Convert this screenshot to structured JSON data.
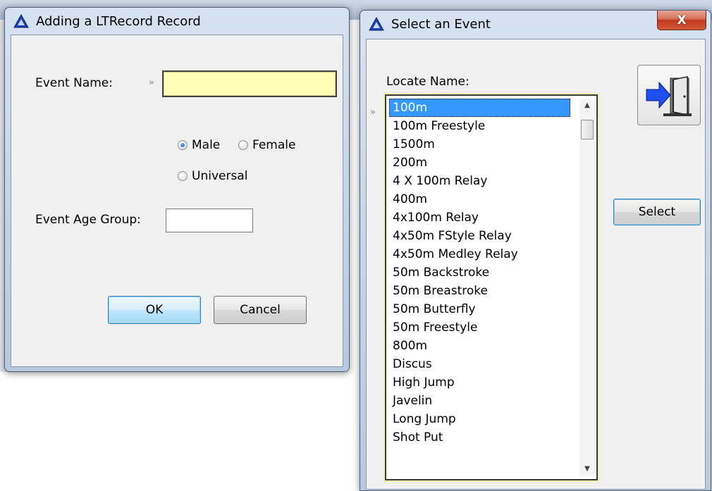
{
  "background": {
    "visible_text": ""
  },
  "add_dialog": {
    "title": "Adding a LTRecord Record",
    "event_name_label": "Event Name:",
    "event_name_value": "",
    "gender_options": [
      {
        "label": "Male",
        "checked": true
      },
      {
        "label": "Female",
        "checked": false
      },
      {
        "label": "Universal",
        "checked": false
      }
    ],
    "age_group_label": "Event Age Group:",
    "age_group_value": "",
    "ok_label": "OK",
    "cancel_label": "Cancel"
  },
  "select_dialog": {
    "title": "Select an Event",
    "close_label": "X",
    "locate_label": "Locate Name:",
    "select_label": "Select",
    "selected_index": 0,
    "events": [
      "100m",
      "100m Freestyle",
      "1500m",
      "200m",
      "4 X 100m Relay",
      "400m",
      "4x100m Relay",
      "4x50m FStyle Relay",
      "4x50m Medley Relay",
      "50m Backstroke",
      "50m Breastroke",
      "50m Butterfly",
      "50m Freestyle",
      "800m",
      "Discus",
      "High Jump",
      "Javelin",
      "Long Jump",
      "Shot Put"
    ]
  },
  "colors": {
    "selection": "#3399ff",
    "required_field": "#ffffb8",
    "close_button": "#c0391d",
    "title_icon": "#1a3fb0"
  },
  "icons": [
    "warning-triangle-icon",
    "exit-door-icon",
    "chevron-right-icon",
    "scroll-up-icon",
    "scroll-down-icon"
  ]
}
